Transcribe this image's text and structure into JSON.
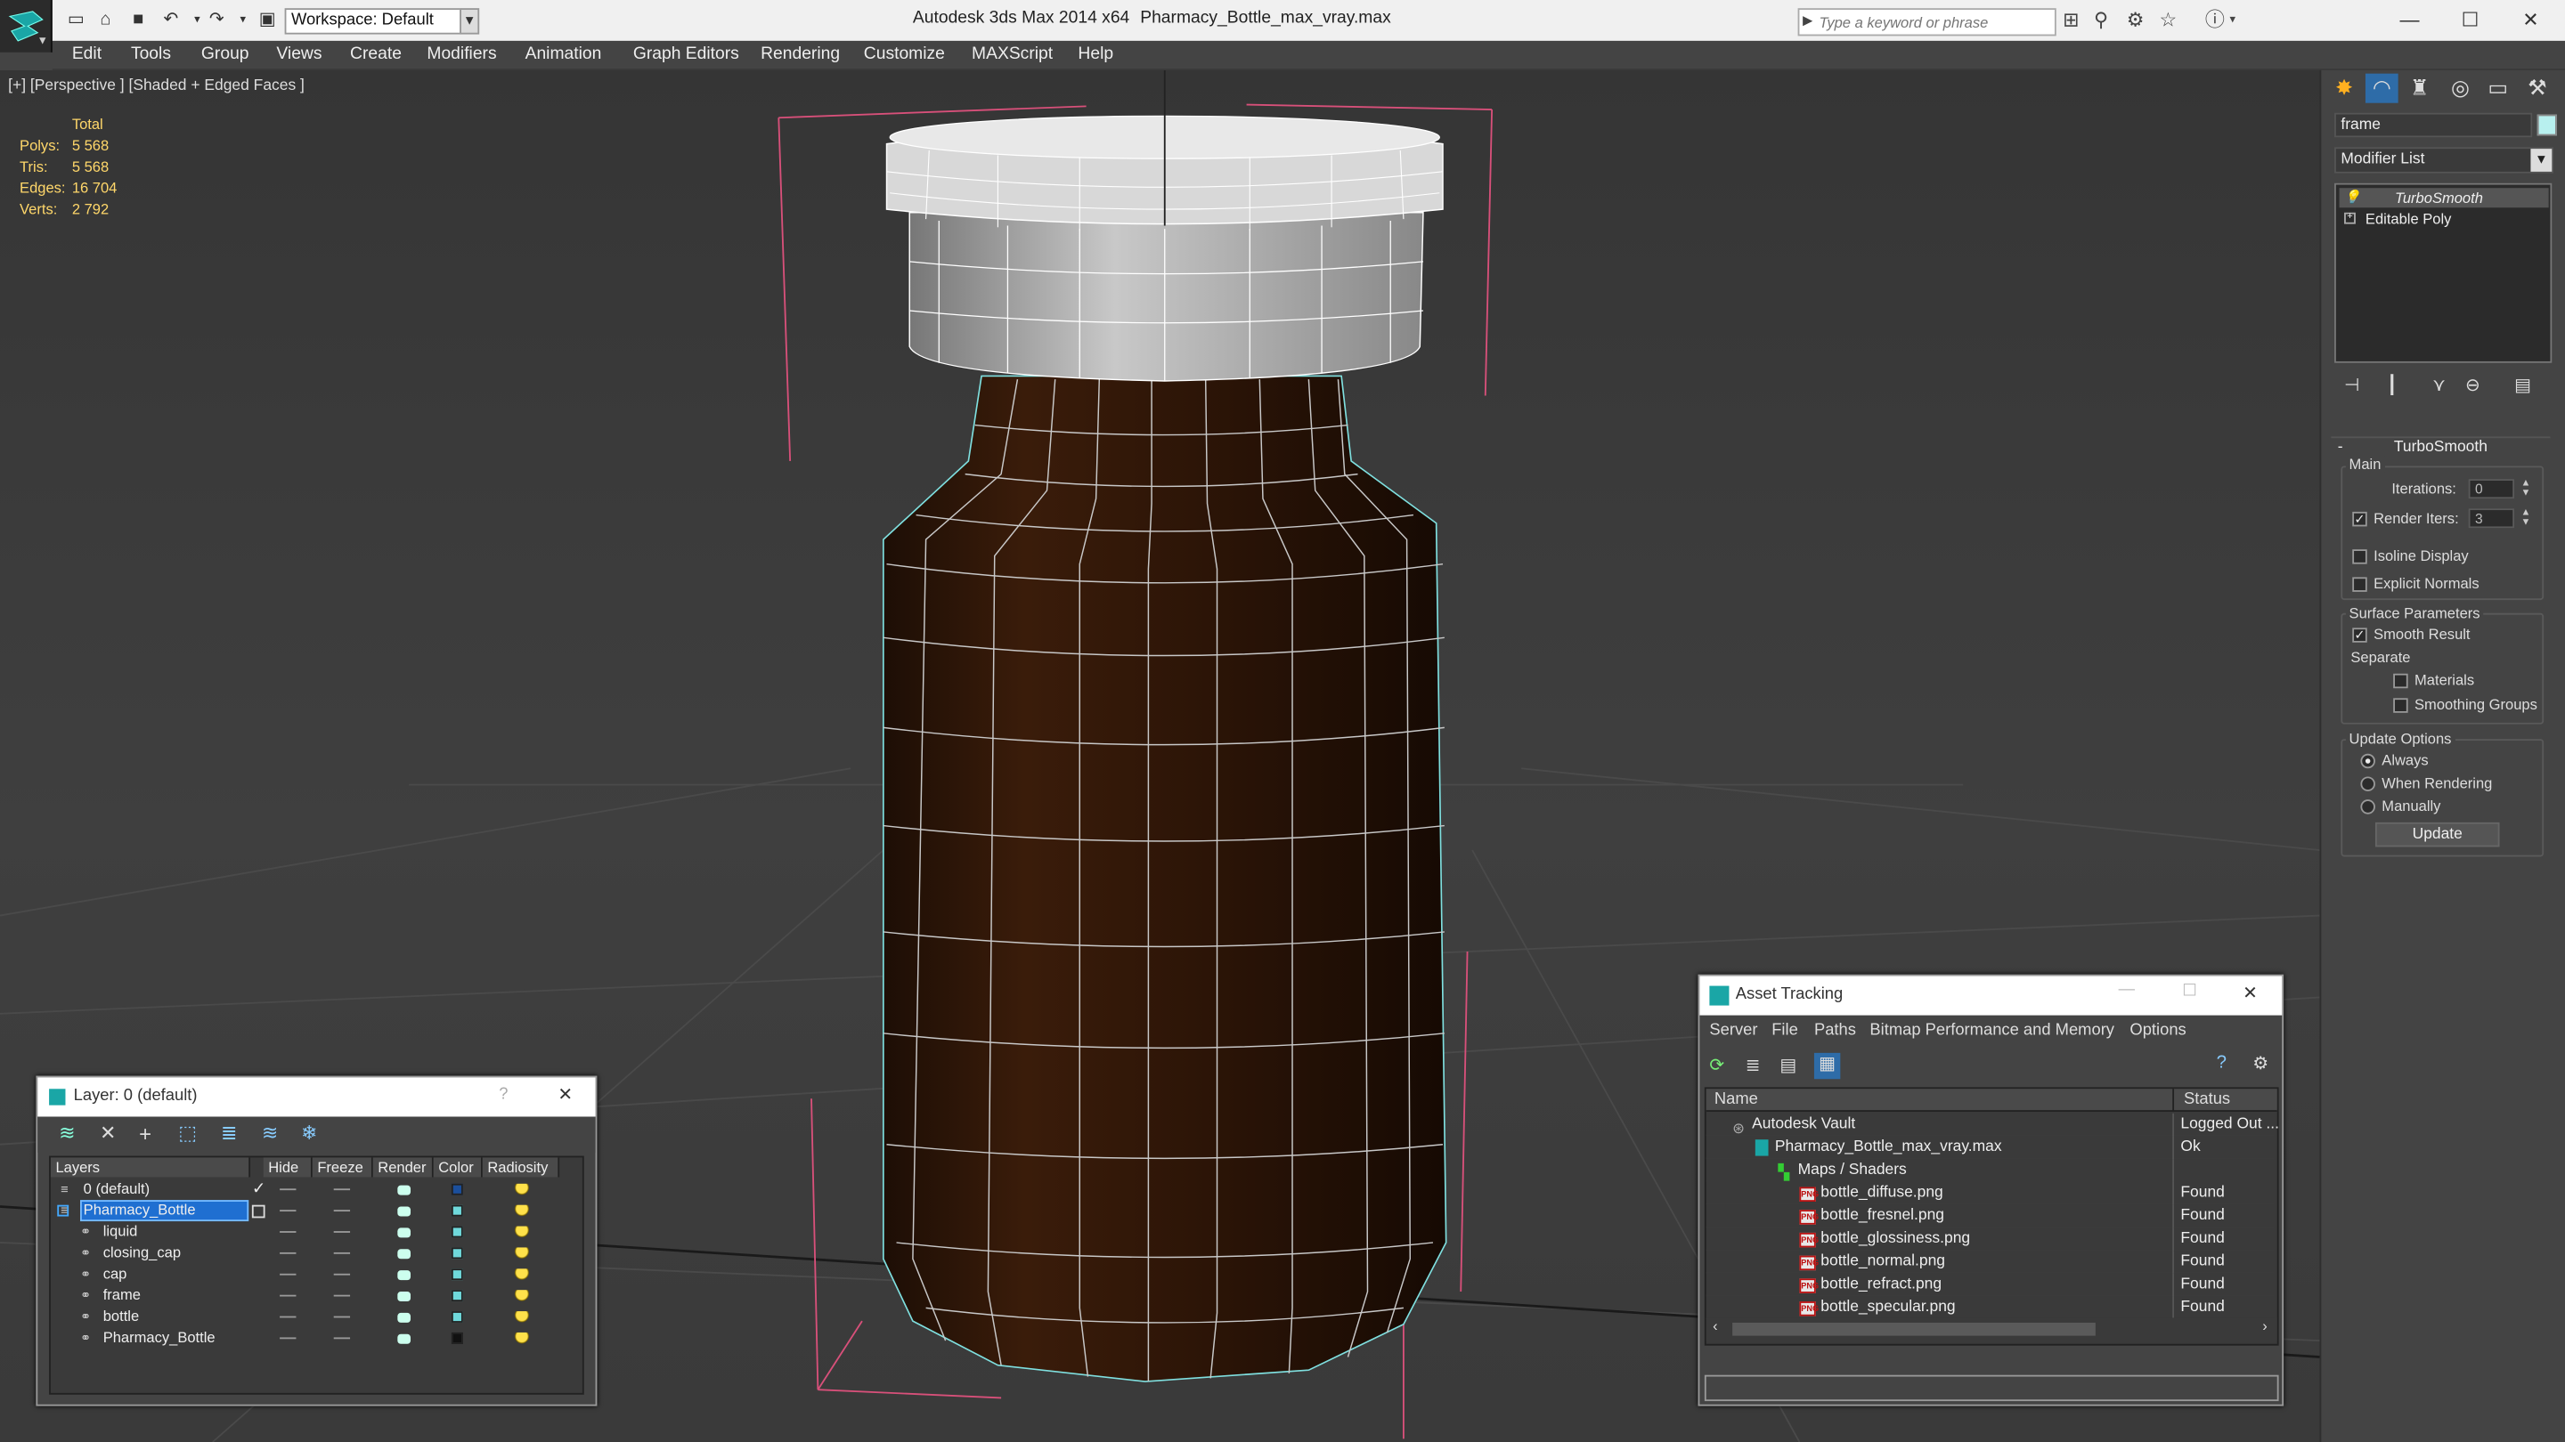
{
  "titlebar": {
    "workspace": "Workspace: Default",
    "app_title": "Autodesk 3ds Max  2014 x64",
    "file_title": "Pharmacy_Bottle_max_vray.max",
    "search_placeholder": "Type a keyword or phrase"
  },
  "menu": [
    "Edit",
    "Tools",
    "Group",
    "Views",
    "Create",
    "Modifiers",
    "Animation",
    "Graph Editors",
    "Rendering",
    "Customize",
    "MAXScript",
    "Help"
  ],
  "viewport": {
    "label": "[+] [Perspective ] [Shaded + Edged Faces ]",
    "stats": {
      "total_label": "Total",
      "rows": [
        {
          "label": "Polys:",
          "value": "5 568"
        },
        {
          "label": "Tris:",
          "value": "5 568"
        },
        {
          "label": "Edges:",
          "value": "16 704"
        },
        {
          "label": "Verts:",
          "value": "2 792"
        }
      ]
    }
  },
  "command_panel": {
    "object_name": "frame",
    "object_color": "#b8f0ef",
    "modifier_list": "Modifier List",
    "stack": [
      "TurboSmooth",
      "Editable Poly"
    ],
    "rollout_title": "TurboSmooth",
    "main_group": "Main",
    "iterations_label": "Iterations:",
    "iterations_value": "0",
    "render_iters_label": "Render Iters:",
    "render_iters_value": "3",
    "isoline_label": "Isoline Display",
    "explicit_normals_label": "Explicit Normals",
    "surface_group": "Surface Parameters",
    "smooth_result_label": "Smooth Result",
    "separate_label": "Separate",
    "materials_label": "Materials",
    "smoothing_groups_label": "Smoothing Groups",
    "update_group": "Update Options",
    "always_label": "Always",
    "when_rendering_label": "When Rendering",
    "manually_label": "Manually",
    "update_button": "Update"
  },
  "layer_dialog": {
    "title": "Layer: 0 (default)",
    "help": "?",
    "columns": [
      "Layers",
      "Hide",
      "Freeze",
      "Render",
      "Color",
      "Radiosity"
    ],
    "rows": [
      {
        "name": "0 (default)",
        "color": "#1b4f9c"
      },
      {
        "name": "Pharmacy_Bottle",
        "color": "#6fd9db"
      },
      {
        "name": "liquid",
        "color": "#6fd9db"
      },
      {
        "name": "closing_cap",
        "color": "#6fd9db"
      },
      {
        "name": "cap",
        "color": "#6fd9db"
      },
      {
        "name": "frame",
        "color": "#6fd9db"
      },
      {
        "name": "bottle",
        "color": "#6fd9db"
      },
      {
        "name": "Pharmacy_Bottle",
        "color": "#111111"
      }
    ]
  },
  "asset_dialog": {
    "title": "Asset Tracking",
    "menu": [
      "Server",
      "File",
      "Paths",
      "Bitmap Performance and Memory",
      "Options"
    ],
    "col_name": "Name",
    "col_status": "Status",
    "rows": [
      {
        "name": "Autodesk Vault",
        "status": "Logged Out ..."
      },
      {
        "name": "Pharmacy_Bottle_max_vray.max",
        "status": "Ok"
      },
      {
        "name": "Maps / Shaders",
        "status": ""
      },
      {
        "name": "bottle_diffuse.png",
        "status": "Found"
      },
      {
        "name": "bottle_fresnel.png",
        "status": "Found"
      },
      {
        "name": "bottle_glossiness.png",
        "status": "Found"
      },
      {
        "name": "bottle_normal.png",
        "status": "Found"
      },
      {
        "name": "bottle_refract.png",
        "status": "Found"
      },
      {
        "name": "bottle_specular.png",
        "status": "Found"
      }
    ]
  }
}
